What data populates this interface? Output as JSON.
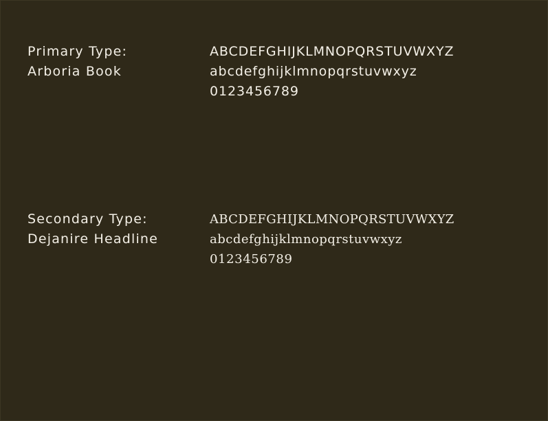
{
  "primary": {
    "label_line1": "Primary Type:",
    "label_line2": "Arboria Book",
    "uppercase": "ABCDEFGHIJKLMNOPQRSTUVWXYZ",
    "lowercase": "abcdefghijklmnopqrstuvwxyz",
    "digits": "0123456789"
  },
  "secondary": {
    "label_line1": "Secondary Type:",
    "label_line2": "Dejanire Headline",
    "uppercase": "ABCDEFGHIJKLMNOPQRSTUVWXYZ",
    "lowercase": "abcdefghijklmnopqrstuvwxyz",
    "digits": "0123456789"
  },
  "colors": {
    "background": "#2f2919",
    "text": "#f3efe6"
  }
}
